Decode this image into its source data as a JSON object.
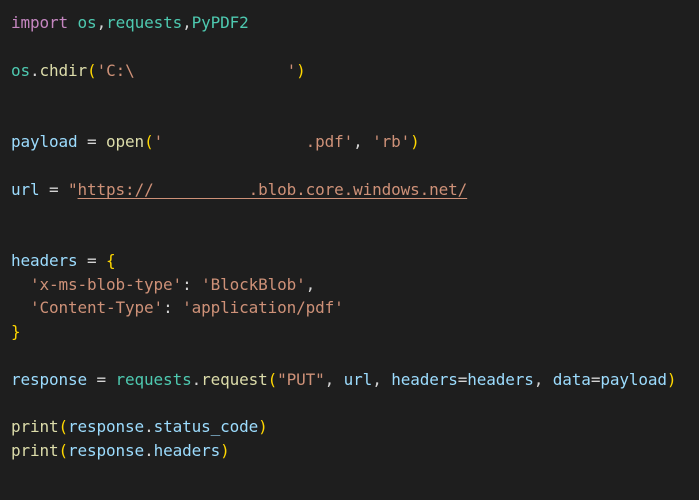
{
  "editor": {
    "lines": [
      {
        "name": "line-import",
        "tokens": [
          {
            "text": "import",
            "cls": "tok-keyword"
          },
          {
            "text": " ",
            "cls": "tok-punct"
          },
          {
            "text": "os",
            "cls": "tok-module"
          },
          {
            "text": ",",
            "cls": "tok-punct"
          },
          {
            "text": "requests",
            "cls": "tok-module"
          },
          {
            "text": ",",
            "cls": "tok-punct"
          },
          {
            "text": "PyPDF2",
            "cls": "tok-module"
          }
        ]
      },
      {
        "name": "line-chdir",
        "tokens": [
          {
            "text": "os",
            "cls": "tok-module"
          },
          {
            "text": ".",
            "cls": "tok-punct"
          },
          {
            "text": "chdir",
            "cls": "tok-func"
          },
          {
            "text": "(",
            "cls": "tok-bracket-1"
          },
          {
            "text": "'C:\\                ",
            "cls": "tok-string"
          },
          {
            "text": "'",
            "cls": "tok-string"
          },
          {
            "text": ")",
            "cls": "tok-bracket-1"
          }
        ]
      },
      {
        "name": "line-payload",
        "tokens": [
          {
            "text": "payload",
            "cls": "tok-var"
          },
          {
            "text": " = ",
            "cls": "tok-punct"
          },
          {
            "text": "open",
            "cls": "tok-func"
          },
          {
            "text": "(",
            "cls": "tok-bracket-1"
          },
          {
            "text": "'               .pdf'",
            "cls": "tok-string"
          },
          {
            "text": ", ",
            "cls": "tok-punct"
          },
          {
            "text": "'rb'",
            "cls": "tok-string"
          },
          {
            "text": ")",
            "cls": "tok-bracket-1"
          }
        ]
      },
      {
        "name": "line-url",
        "tokens": [
          {
            "text": "url",
            "cls": "tok-var"
          },
          {
            "text": " = ",
            "cls": "tok-punct"
          },
          {
            "text": "\"",
            "cls": "tok-string"
          },
          {
            "text": "https://          .blob.core.windows.net/",
            "cls": "tok-link"
          }
        ]
      },
      {
        "name": "line-headers-open",
        "tokens": [
          {
            "text": "headers",
            "cls": "tok-var"
          },
          {
            "text": " = ",
            "cls": "tok-punct"
          },
          {
            "text": "{",
            "cls": "tok-bracket-1"
          }
        ]
      },
      {
        "name": "line-header-blob-type",
        "tokens": [
          {
            "text": "  ",
            "cls": "tok-punct"
          },
          {
            "text": "'x-ms-blob-type'",
            "cls": "tok-string"
          },
          {
            "text": ": ",
            "cls": "tok-punct"
          },
          {
            "text": "'BlockBlob'",
            "cls": "tok-string"
          },
          {
            "text": ",",
            "cls": "tok-punct"
          }
        ]
      },
      {
        "name": "line-header-content-type",
        "tokens": [
          {
            "text": "  ",
            "cls": "tok-punct"
          },
          {
            "text": "'Content-Type'",
            "cls": "tok-string"
          },
          {
            "text": ": ",
            "cls": "tok-punct"
          },
          {
            "text": "'application/pdf'",
            "cls": "tok-string"
          }
        ]
      },
      {
        "name": "line-headers-close",
        "tokens": [
          {
            "text": "}",
            "cls": "tok-bracket-1"
          }
        ]
      },
      {
        "name": "line-response",
        "tokens": [
          {
            "text": "response",
            "cls": "tok-var"
          },
          {
            "text": " = ",
            "cls": "tok-punct"
          },
          {
            "text": "requests",
            "cls": "tok-module"
          },
          {
            "text": ".",
            "cls": "tok-punct"
          },
          {
            "text": "request",
            "cls": "tok-func"
          },
          {
            "text": "(",
            "cls": "tok-bracket-1"
          },
          {
            "text": "\"PUT\"",
            "cls": "tok-string"
          },
          {
            "text": ", ",
            "cls": "tok-punct"
          },
          {
            "text": "url",
            "cls": "tok-var"
          },
          {
            "text": ", ",
            "cls": "tok-punct"
          },
          {
            "text": "headers",
            "cls": "tok-var"
          },
          {
            "text": "=",
            "cls": "tok-punct"
          },
          {
            "text": "headers",
            "cls": "tok-var"
          },
          {
            "text": ", ",
            "cls": "tok-punct"
          },
          {
            "text": "data",
            "cls": "tok-var"
          },
          {
            "text": "=",
            "cls": "tok-punct"
          },
          {
            "text": "payload",
            "cls": "tok-var"
          },
          {
            "text": ")",
            "cls": "tok-bracket-1"
          }
        ]
      },
      {
        "name": "line-print-status",
        "tokens": [
          {
            "text": "print",
            "cls": "tok-func"
          },
          {
            "text": "(",
            "cls": "tok-bracket-1"
          },
          {
            "text": "response",
            "cls": "tok-var"
          },
          {
            "text": ".",
            "cls": "tok-punct"
          },
          {
            "text": "status_code",
            "cls": "tok-var"
          },
          {
            "text": ")",
            "cls": "tok-bracket-1"
          }
        ]
      },
      {
        "name": "line-print-headers",
        "tokens": [
          {
            "text": "print",
            "cls": "tok-func"
          },
          {
            "text": "(",
            "cls": "tok-bracket-1"
          },
          {
            "text": "response",
            "cls": "tok-var"
          },
          {
            "text": ".",
            "cls": "tok-punct"
          },
          {
            "text": "headers",
            "cls": "tok-var"
          },
          {
            "text": ")",
            "cls": "tok-bracket-1"
          }
        ]
      }
    ]
  }
}
